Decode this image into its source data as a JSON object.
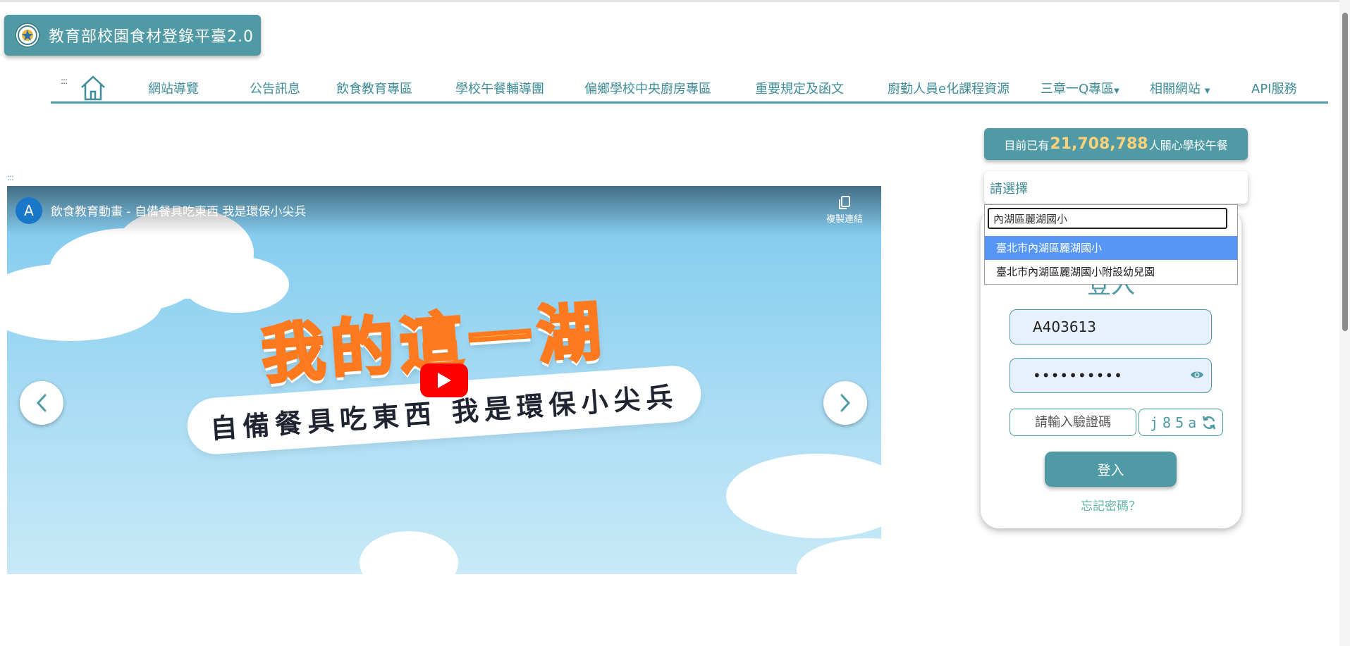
{
  "header": {
    "logo_title": "教育部校園食材登錄平臺2.0"
  },
  "nav": {
    "menu_handle": ":::",
    "items": [
      {
        "label": "網站導覽"
      },
      {
        "label": "公告訊息"
      },
      {
        "label": "飲食教育專區"
      },
      {
        "label": "學校午餐輔導團"
      },
      {
        "label": "偏鄉學校中央廚房專區"
      },
      {
        "label": "重要規定及函文"
      },
      {
        "label": "廚勤人員e化課程資源"
      },
      {
        "label": "三章一Q專區"
      },
      {
        "label": "相關網站"
      },
      {
        "label": "API服務"
      }
    ]
  },
  "video": {
    "section_handle": ":::",
    "channel_initial": "A",
    "title": "飲食教育動畫 - 自備餐具吃東西 我是環保小尖兵",
    "copy_link_label": "複製連結",
    "art_title": "我的這一湖",
    "banner_text": "自備餐具吃東西 我是環保小尖兵"
  },
  "counter": {
    "prefix": "目前已有",
    "count": "21,708,788",
    "suffix": "人關心學校午餐"
  },
  "school_select": {
    "label": "請選擇",
    "search_value": "內湖區麗湖國小",
    "options": [
      {
        "label": "臺北市內湖區麗湖國小",
        "highlighted": true
      },
      {
        "label": "臺北市內湖區麗湖國小附設幼兒園",
        "highlighted": false
      }
    ]
  },
  "login": {
    "title": "登入",
    "account_value": "A403613",
    "password_value": "••••••••••",
    "captcha_placeholder": "請輸入驗證碼",
    "captcha_code": "j85a",
    "submit_label": "登入",
    "forgot_label": "忘記密碼？"
  },
  "colors": {
    "accent": "#4f9aa5",
    "highlight": "#5697f6",
    "counter_number": "#ffd27a",
    "link": "#5fb8a8"
  }
}
